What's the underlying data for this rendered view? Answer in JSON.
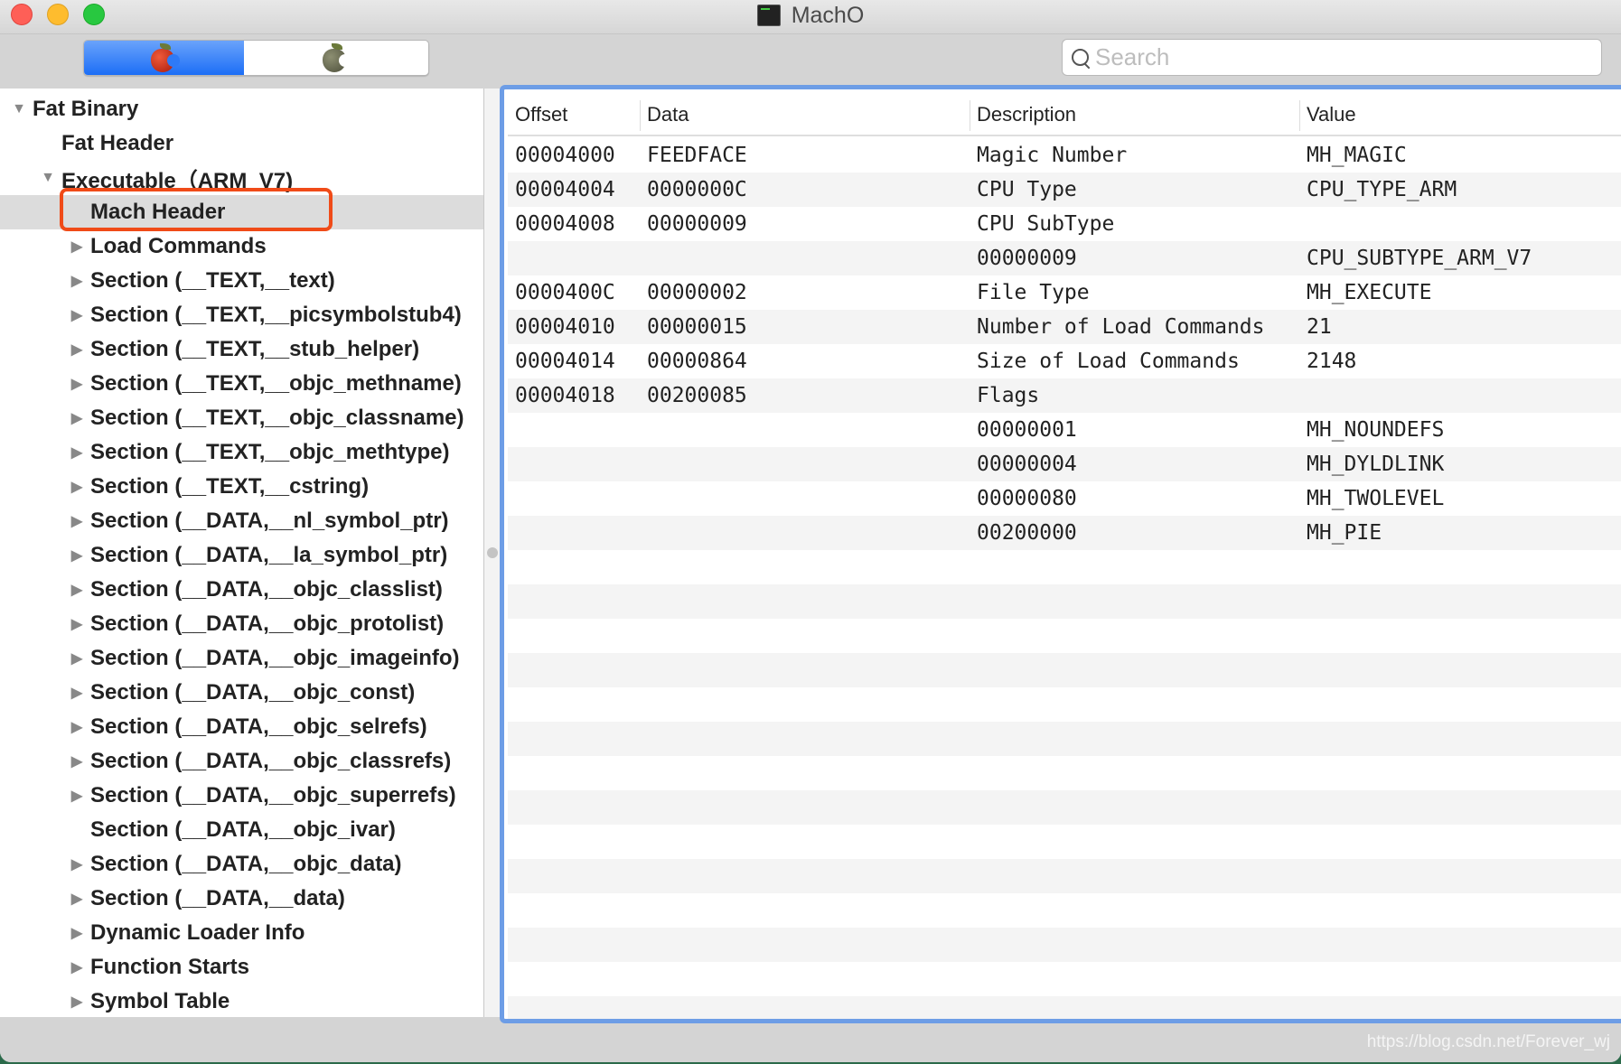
{
  "window": {
    "title": "MachO",
    "title_icon": "terminal-icon"
  },
  "toolbar": {
    "segments": [
      {
        "icon": "red-apple-icon",
        "active": true
      },
      {
        "icon": "gray-apple-icon",
        "active": false
      }
    ],
    "search": {
      "placeholder": "Search",
      "value": ""
    }
  },
  "tree": {
    "items": [
      {
        "label": "Fat Binary",
        "level": 0,
        "disclosure": "expanded"
      },
      {
        "label": "Fat Header",
        "level": 1,
        "disclosure": "none"
      },
      {
        "label": "Executable（ARM_V7)",
        "level": 1,
        "disclosure": "expanded"
      },
      {
        "label": "Mach Header",
        "level": 2,
        "disclosure": "none",
        "selected": true
      },
      {
        "label": "Load Commands",
        "level": 2,
        "disclosure": "collapsed"
      },
      {
        "label": "Section (__TEXT,__text)",
        "level": 2,
        "disclosure": "collapsed"
      },
      {
        "label": "Section (__TEXT,__picsymbolstub4)",
        "level": 2,
        "disclosure": "collapsed"
      },
      {
        "label": "Section (__TEXT,__stub_helper)",
        "level": 2,
        "disclosure": "collapsed"
      },
      {
        "label": "Section (__TEXT,__objc_methname)",
        "level": 2,
        "disclosure": "collapsed"
      },
      {
        "label": "Section (__TEXT,__objc_classname)",
        "level": 2,
        "disclosure": "collapsed"
      },
      {
        "label": "Section (__TEXT,__objc_methtype)",
        "level": 2,
        "disclosure": "collapsed"
      },
      {
        "label": "Section (__TEXT,__cstring)",
        "level": 2,
        "disclosure": "collapsed"
      },
      {
        "label": "Section (__DATA,__nl_symbol_ptr)",
        "level": 2,
        "disclosure": "collapsed"
      },
      {
        "label": "Section (__DATA,__la_symbol_ptr)",
        "level": 2,
        "disclosure": "collapsed"
      },
      {
        "label": "Section (__DATA,__objc_classlist)",
        "level": 2,
        "disclosure": "collapsed"
      },
      {
        "label": "Section (__DATA,__objc_protolist)",
        "level": 2,
        "disclosure": "collapsed"
      },
      {
        "label": "Section (__DATA,__objc_imageinfo)",
        "level": 2,
        "disclosure": "collapsed"
      },
      {
        "label": "Section (__DATA,__objc_const)",
        "level": 2,
        "disclosure": "collapsed"
      },
      {
        "label": "Section (__DATA,__objc_selrefs)",
        "level": 2,
        "disclosure": "collapsed"
      },
      {
        "label": "Section (__DATA,__objc_classrefs)",
        "level": 2,
        "disclosure": "collapsed"
      },
      {
        "label": "Section (__DATA,__objc_superrefs)",
        "level": 2,
        "disclosure": "collapsed"
      },
      {
        "label": "Section (__DATA,__objc_ivar)",
        "level": 2,
        "disclosure": "none"
      },
      {
        "label": "Section (__DATA,__objc_data)",
        "level": 2,
        "disclosure": "collapsed"
      },
      {
        "label": "Section (__DATA,__data)",
        "level": 2,
        "disclosure": "collapsed"
      },
      {
        "label": "Dynamic Loader Info",
        "level": 2,
        "disclosure": "collapsed"
      },
      {
        "label": "Function Starts",
        "level": 2,
        "disclosure": "collapsed"
      },
      {
        "label": "Symbol Table",
        "level": 2,
        "disclosure": "collapsed"
      }
    ]
  },
  "table": {
    "columns": [
      "Offset",
      "Data",
      "Description",
      "Value"
    ],
    "rows": [
      [
        "00004000",
        "FEEDFACE",
        "Magic Number",
        "MH_MAGIC"
      ],
      [
        "00004004",
        "0000000C",
        "CPU Type",
        "CPU_TYPE_ARM"
      ],
      [
        "00004008",
        "00000009",
        "CPU SubType",
        ""
      ],
      [
        "",
        "",
        "00000009",
        "CPU_SUBTYPE_ARM_V7"
      ],
      [
        "0000400C",
        "00000002",
        "File Type",
        "MH_EXECUTE"
      ],
      [
        "00004010",
        "00000015",
        "Number of Load Commands",
        "21"
      ],
      [
        "00004014",
        "00000864",
        "Size of Load Commands",
        "2148"
      ],
      [
        "00004018",
        "00200085",
        "Flags",
        ""
      ],
      [
        "",
        "",
        "00000001",
        "MH_NOUNDEFS"
      ],
      [
        "",
        "",
        "00000004",
        "MH_DYLDLINK"
      ],
      [
        "",
        "",
        "00000080",
        "MH_TWOLEVEL"
      ],
      [
        "",
        "",
        "00200000",
        "MH_PIE"
      ]
    ],
    "empty_rows": 14
  },
  "watermark": "https://blog.csdn.net/Forever_wj",
  "colors": {
    "focus_ring": "#6d9de6",
    "segment_active": "#1c6ef6",
    "annotation_box": "#f04b18",
    "selected_row": "#dcdcdc"
  }
}
